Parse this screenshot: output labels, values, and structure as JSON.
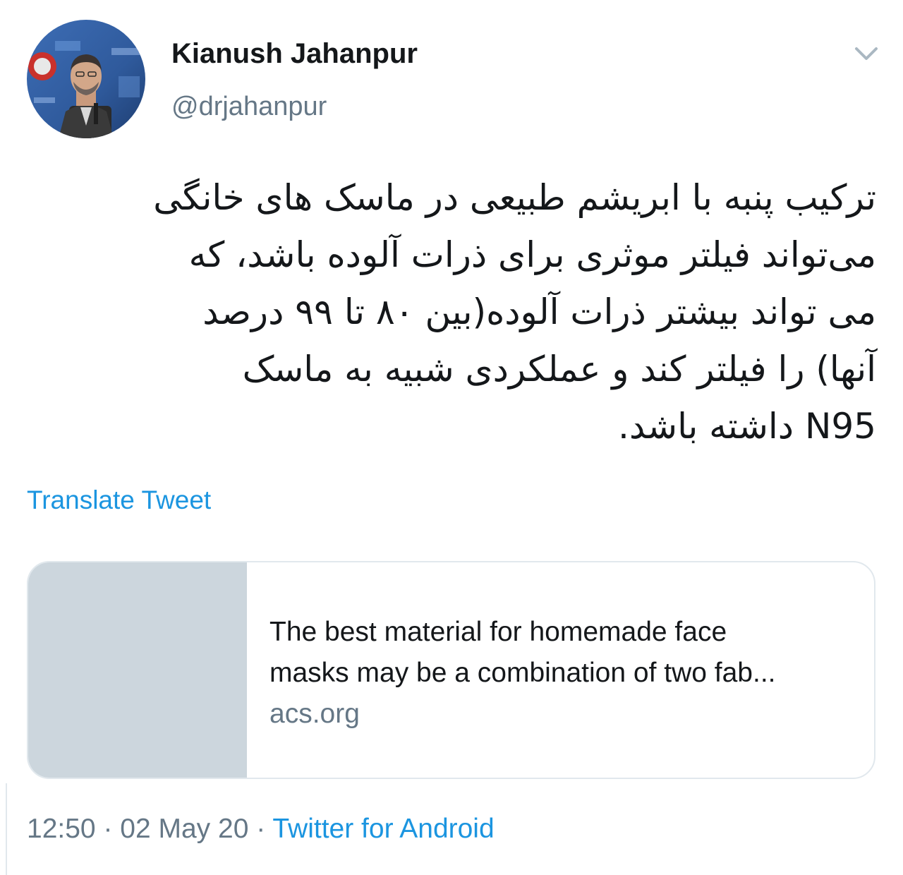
{
  "author": {
    "display_name": "Kianush Jahanpur",
    "handle": "@drjahanpur"
  },
  "icons": {
    "menu": "chevron-down-icon",
    "avatar": "profile-photo"
  },
  "tweet": {
    "text_lines": [
      "ترکیب پنبه با ابریشم طبیعی در ماسک های خانگی",
      "می‌تواند فیلتر موثری برای ذرات آلوده باشد، که",
      "می تواند بیشتر ذرات آلوده(بین ۸۰ تا ۹۹ درصد",
      "آنها) را فیلتر کند و عملکردی شبیه به ماسک",
      "N95 داشته باشد."
    ]
  },
  "translate_label": "Translate Tweet",
  "link_card": {
    "title_lines": [
      "The best material for homemade face",
      "masks may be a combination of two fab..."
    ],
    "domain": "acs.org"
  },
  "meta": {
    "time": "12:50",
    "separator_1": " · ",
    "date": "02 May 20",
    "separator_2": " · ",
    "source": "Twitter for Android"
  },
  "colors": {
    "link_blue": "#1b95e0",
    "secondary_gray": "#657786",
    "text_primary": "#14171a",
    "card_border": "#e1e8ed",
    "thumb_placeholder": "#ccd6dd"
  }
}
